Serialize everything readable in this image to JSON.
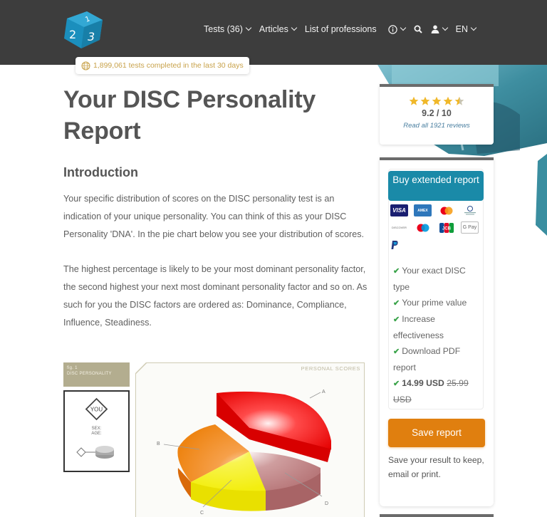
{
  "header": {
    "logo_alt": "123test logo",
    "nav": [
      {
        "label": "Tests (36)",
        "has_dropdown": true
      },
      {
        "label": "Articles",
        "has_dropdown": true
      },
      {
        "label": "List of professions",
        "has_dropdown": false
      }
    ],
    "icons": [
      {
        "name": "info-icon",
        "has_dropdown": true
      },
      {
        "name": "search-icon",
        "has_dropdown": false
      },
      {
        "name": "user-icon",
        "has_dropdown": true
      }
    ],
    "language": "EN"
  },
  "counter": {
    "icon": "globe-icon",
    "text": "1,899,061 tests completed in the last 30 days"
  },
  "main": {
    "title": "Your DISC Personality Report",
    "section_heading": "Introduction",
    "paragraphs": [
      "Your specific distribution of scores on the DISC personality test is an indication of your unique personality. You can think of this as your DISC Personality 'DNA'. In the pie chart below you see your distribution of scores.",
      "The highest percentage is likely to be your most dominant personality factor, the second highest your next most dominant personality factor and so on. As such for you the DISC factors are ordered as: Dominance, Compliance, Influence, Steadiness."
    ]
  },
  "figure": {
    "fig_number": "fig. 1",
    "fig_title": "DISC PERSONALITY",
    "legend_you": "YOU",
    "legend_sex": "SEX:",
    "legend_age": "AGE:",
    "legend_small": "YOU",
    "chart_title": "PERSONAL SCORES",
    "slices": [
      {
        "label": "A",
        "color": "#e60000",
        "exploded": true
      },
      {
        "label": "B",
        "color": "#f08a1c",
        "exploded": false
      },
      {
        "label": "C",
        "color": "#f3ee10",
        "exploded": false
      },
      {
        "label": "D",
        "color": "#b8787a",
        "exploded": false
      }
    ]
  },
  "rating": {
    "stars": 4.5,
    "max_stars": 5,
    "score": "9.2 / 10",
    "reviews_link": "Read all 1921 reviews",
    "star_color": "#f0b82a"
  },
  "purchase": {
    "buy_button": "Buy extended report",
    "payment_methods": [
      "VISA",
      "AMEX",
      "Mastercard",
      "Diners Club",
      "Discover",
      "Maestro",
      "JCB",
      "G Pay",
      "PayPal"
    ],
    "features": [
      "Your exact DISC type",
      "Your prime value",
      "Increase effectiveness",
      "Download PDF report"
    ],
    "price": "14.99 USD",
    "old_price": "25.99 USD",
    "save_button": "Save report",
    "save_note": "Save your result to keep, email or print."
  },
  "colors": {
    "header_bg": "#3d3d3d",
    "brand_blue": "#1a8aa8",
    "save_orange": "#e07f0f",
    "check_green": "#3aa34a",
    "counter_gold": "#c8a24a"
  }
}
